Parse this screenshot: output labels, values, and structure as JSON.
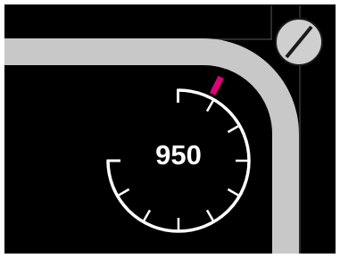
{
  "game": {
    "speed_readout": "950",
    "track_icon": "curved-track-icon",
    "rotate_button_icon": "diagonal-slash-icon"
  },
  "colors": {
    "background": "#000000",
    "track": "#c8c8c8",
    "frame": "#ffffff",
    "gauge": "#ffffff",
    "needle": "#e0007a",
    "button_fill": "#cfcfcf",
    "button_stroke": "#1a1a1a"
  }
}
